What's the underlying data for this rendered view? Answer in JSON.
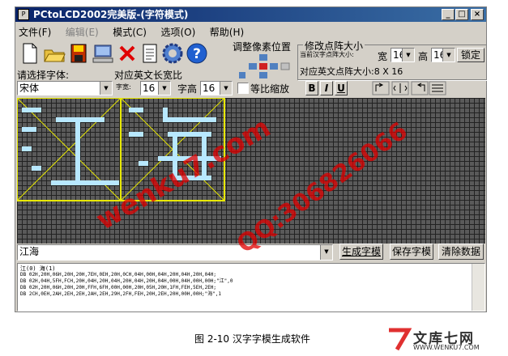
{
  "window": {
    "title": "PCtoLCD2002完美版-(字符模式)",
    "min": "_",
    "max": "□",
    "close": "×"
  },
  "menu": [
    "文件(F)",
    "编辑(E)",
    "模式(C)",
    "选项(O)",
    "帮助(H)"
  ],
  "adjust": {
    "label": "调整像素位置"
  },
  "dot_size": {
    "label": "修改点阵大小",
    "current_label": "当前汉字点阵大小:",
    "width_label": "宽",
    "width_value": "16",
    "height_label": "高",
    "height_value": "16",
    "lock_button": "锁定",
    "ascii_label": "对应英文点阵大小:8 X 16"
  },
  "font": {
    "label": "请选择字体:",
    "value": "宋体"
  },
  "ratio": {
    "label": "对应英文长宽比",
    "width_label": "字宽:",
    "width_value": "16",
    "height_label": "字高",
    "height_value": "16",
    "scale_label": "等比缩放"
  },
  "style_buttons": [
    "B",
    "I",
    "U"
  ],
  "input": {
    "value": "江海"
  },
  "buttons": {
    "generate": "生成字模",
    "save": "保存字模",
    "clear": "清除数据"
  },
  "output": {
    "lines": [
      "江(0) 海(1)",
      "",
      "DB 02H,20H,06H,20H,20H,7EH,0EH,20H,0CH,04H,00H,04H,20H,04H,20H,04H;",
      "DB 02H,04H,5FH,FCH,20H,04H,20H,04H,20H,04H,20H,04H,00H,04H,00H,00H;\"江\",0",
      "",
      "DB 02H,20H,06H,20H,20H,FFH,6FH,00H,00H,20H,05H,20H,1FH,FEH,5EH,2EH;",
      "DB 2CH,0EH,2AH,2EH,2EH,2AH,2EH,29H,2FH,FEH,20H,2EH,20H,00H,00H;\"海\",1"
    ]
  },
  "caption": "图 2-10 汉字字模生成软件",
  "watermarks": {
    "site": "wenku7.com",
    "qq": "QQ:306826066",
    "brand": "文库七网",
    "brand_url": "WWW.WENKU7.COM"
  }
}
